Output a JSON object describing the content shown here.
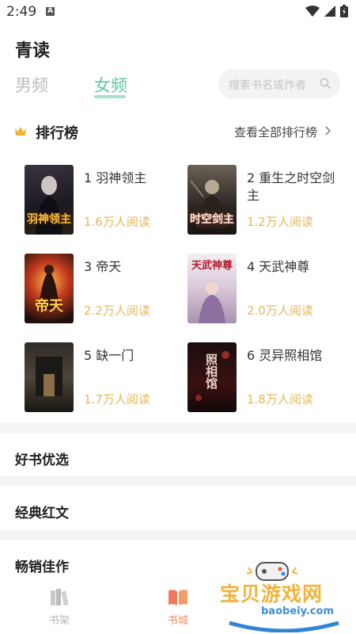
{
  "status": {
    "time": "2:49",
    "a_badge": "A"
  },
  "app": {
    "title": "青读"
  },
  "tabs": [
    {
      "label": "男频",
      "active": false
    },
    {
      "label": "女频",
      "active": true
    }
  ],
  "search": {
    "placeholder": "搜索书名或作者"
  },
  "ranking": {
    "title": "排行榜",
    "more_label": "查看全部排行榜",
    "books": [
      {
        "title": "1 羽神领主",
        "reads": "1.6万人阅读",
        "cover_text": "羽神领主"
      },
      {
        "title": "2 重生之时空剑主",
        "reads": "1.2万人阅读",
        "cover_text": "时空剑主"
      },
      {
        "title": "3 帝天",
        "reads": "2.2万人阅读",
        "cover_text": "帝天"
      },
      {
        "title": "4 天武神尊",
        "reads": "2.0万人阅读",
        "cover_text": "天武神尊"
      },
      {
        "title": "5 缺一门",
        "reads": "1.7万人阅读",
        "cover_text": ""
      },
      {
        "title": "6 灵异照相馆",
        "reads": "1.8万人阅读",
        "cover_text": "照相馆"
      }
    ]
  },
  "sections": [
    {
      "label": "好书优选"
    },
    {
      "label": "经典红文"
    },
    {
      "label": "畅销佳作"
    }
  ],
  "bottom_nav": [
    {
      "label": "书架",
      "active": false
    },
    {
      "label": "书城",
      "active": true
    }
  ],
  "watermark": {
    "text": "宝贝游戏网",
    "url": "baobeiy.com"
  },
  "colors": {
    "accent": "#5cc8a2",
    "reads": "#e2b95a",
    "nav_active": "#f08a5d"
  }
}
